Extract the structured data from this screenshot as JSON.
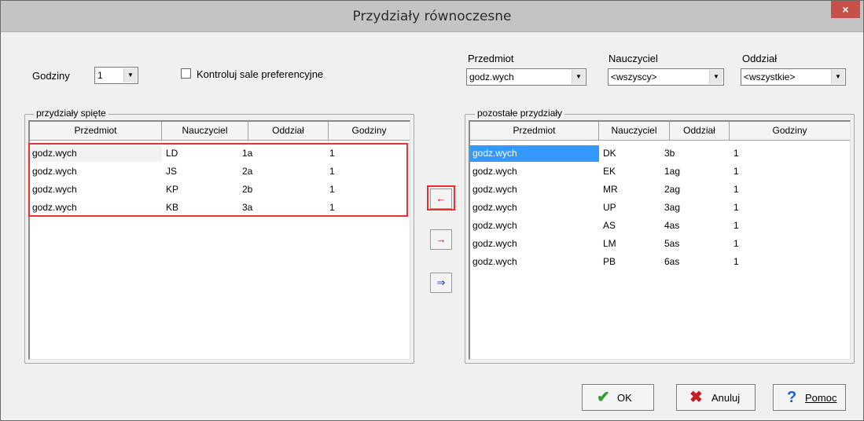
{
  "window": {
    "title": "Przydziały równoczesne",
    "close_glyph": "×"
  },
  "top": {
    "godziny_label": "Godziny",
    "godziny_value": "1",
    "checkbox_label": "Kontroluj sale preferencyjne",
    "checkbox_checked": false
  },
  "filters": {
    "przedmiot": {
      "label": "Przedmiot",
      "value": "godz.wych"
    },
    "nauczyciel": {
      "label": "Nauczyciel",
      "value": "<wszyscy>"
    },
    "oddzial": {
      "label": "Oddział",
      "value": "<wszystkie>"
    }
  },
  "left_panel": {
    "title": "przydziały spięte",
    "columns": [
      "Przedmiot",
      "Nauczyciel",
      "Oddział",
      "Godziny"
    ],
    "rows": [
      [
        "godz.wych",
        "LD",
        "1a",
        "1"
      ],
      [
        "godz.wych",
        "JS",
        "2a",
        "1"
      ],
      [
        "godz.wych",
        "KP",
        "2b",
        "1"
      ],
      [
        "godz.wych",
        "KB",
        "3a",
        "1"
      ]
    ]
  },
  "right_panel": {
    "title": "pozostałe przydziały",
    "columns": [
      "Przedmiot",
      "Nauczyciel",
      "Oddział",
      "Godziny"
    ],
    "rows": [
      [
        "godz.wych",
        "DK",
        "3b",
        "1"
      ],
      [
        "godz.wych",
        "EK",
        "1ag",
        "1"
      ],
      [
        "godz.wych",
        "MR",
        "2ag",
        "1"
      ],
      [
        "godz.wych",
        "UP",
        "3ag",
        "1"
      ],
      [
        "godz.wych",
        "AS",
        "4as",
        "1"
      ],
      [
        "godz.wych",
        "LM",
        "5as",
        "1"
      ],
      [
        "godz.wych",
        "PB",
        "6as",
        "1"
      ]
    ],
    "selected_row": 0
  },
  "transfer_buttons": {
    "move_left": "←",
    "move_right": "→",
    "move_all_right": "⇒"
  },
  "buttons": {
    "ok": "OK",
    "cancel": "Anuluj",
    "help": "Pomoc",
    "ok_icon": "✔",
    "cancel_icon": "✖",
    "help_icon": "?"
  },
  "colors": {
    "highlight": "#e8312f",
    "selection": "#3399ff",
    "close_button": "#c7504a"
  }
}
